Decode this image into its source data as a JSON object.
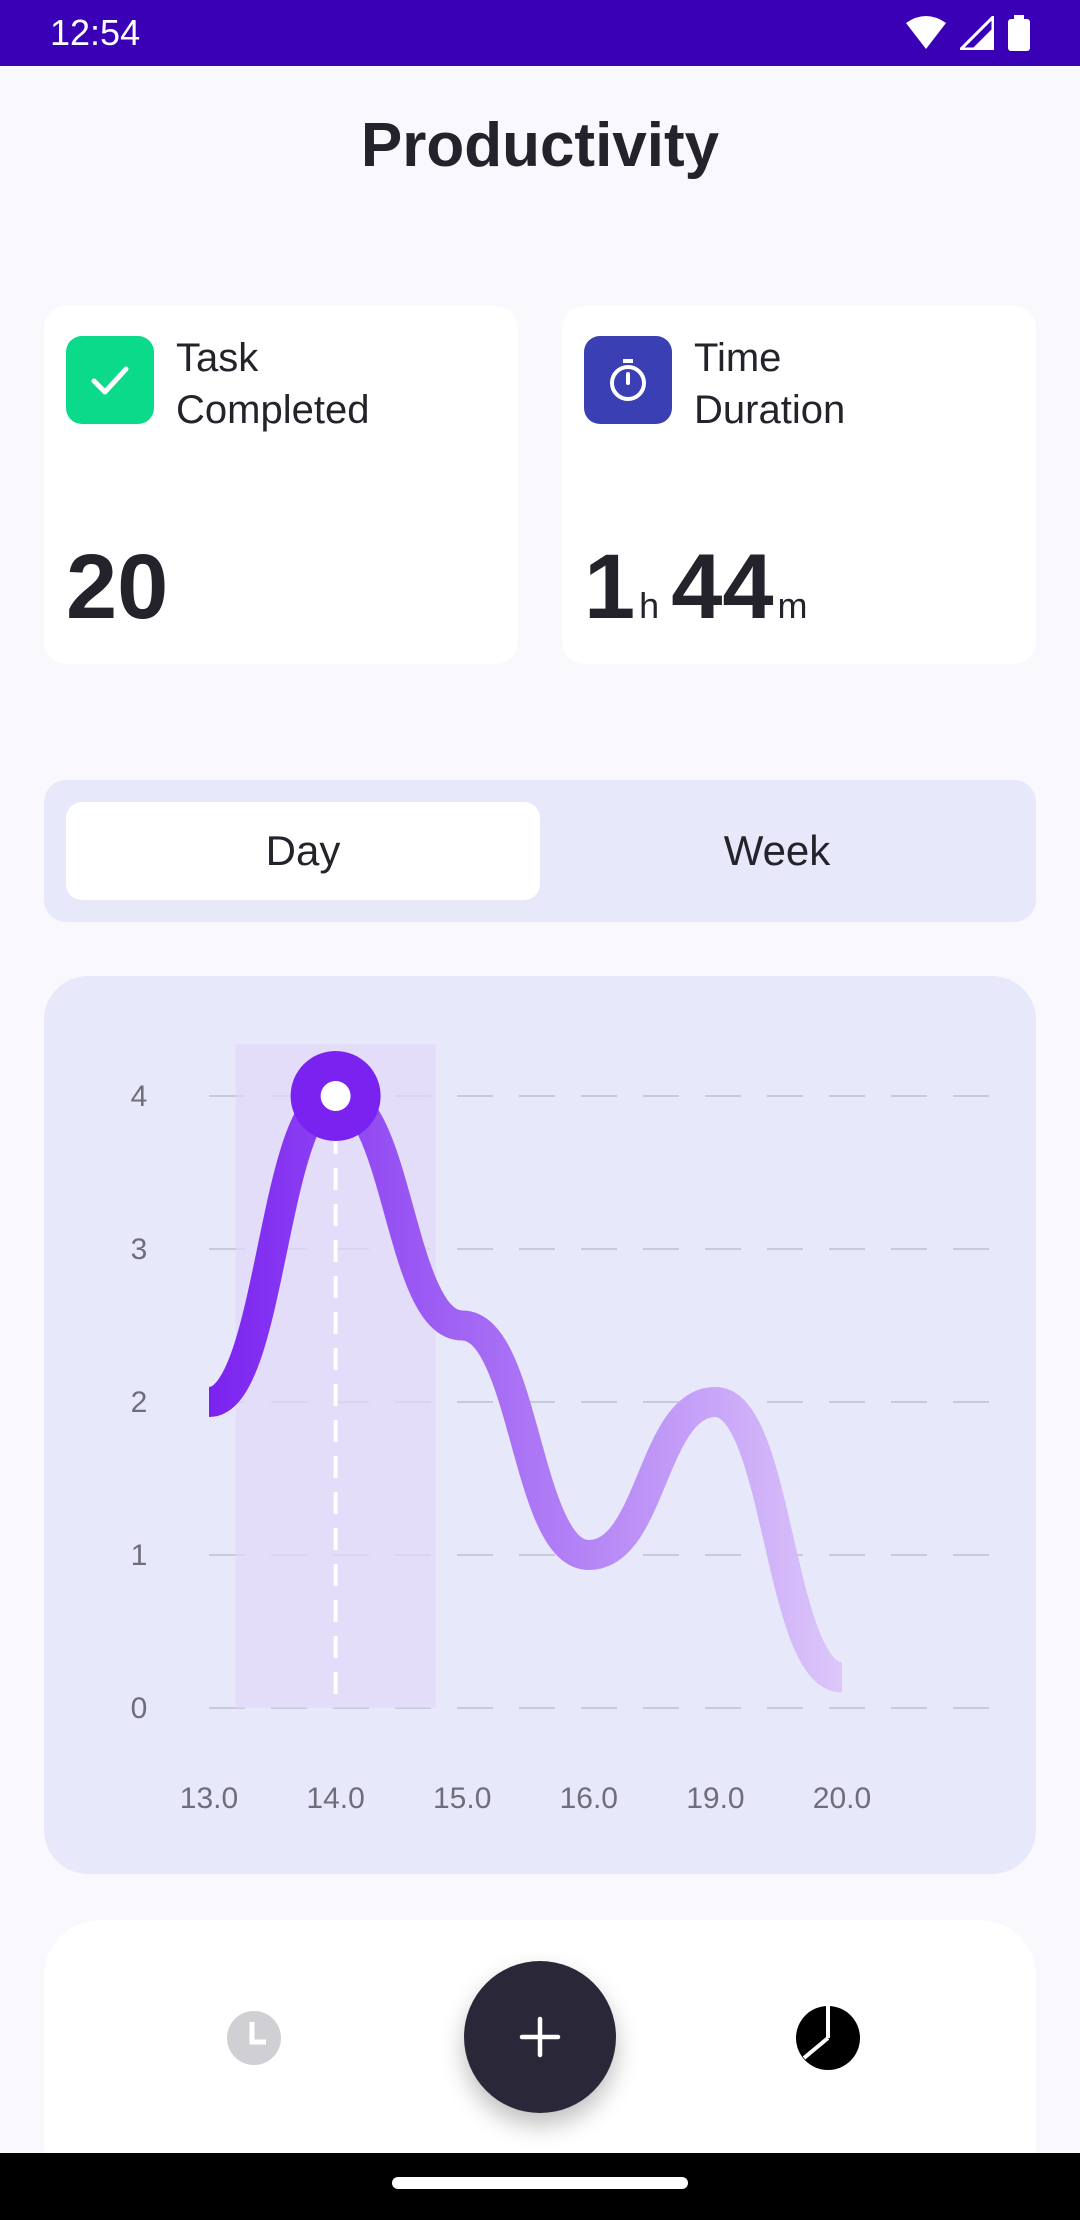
{
  "status_bar": {
    "time": "12:54",
    "icons": [
      "wifi-icon",
      "signal-icon",
      "battery-icon"
    ]
  },
  "page": {
    "title": "Productivity"
  },
  "cards": {
    "tasks": {
      "label_line1": "Task",
      "label_line2": "Completed",
      "value": "20",
      "icon": "check-icon",
      "color": "#0BDA8A"
    },
    "time": {
      "label_line1": "Time",
      "label_line2": "Duration",
      "hours": "1",
      "hours_unit": "h",
      "minutes": "44",
      "minutes_unit": "m",
      "icon": "stopwatch-icon",
      "color": "#3A3FB3"
    }
  },
  "toggle": {
    "day": "Day",
    "week": "Week",
    "selected": "Day"
  },
  "chart_data": {
    "type": "line",
    "categories": [
      "13.0",
      "14.0",
      "15.0",
      "16.0",
      "19.0",
      "20.0"
    ],
    "values": [
      2.0,
      4.0,
      2.5,
      1.0,
      2.0,
      0.2
    ],
    "yticks": [
      "0",
      "1",
      "2",
      "3",
      "4"
    ],
    "ylim": [
      0,
      4
    ],
    "highlighted_category": "14.0",
    "grid": "horizontal dashed",
    "colors": {
      "line_start": "#7A22F0",
      "line_end": "#DCC7FA",
      "highlight": "#E2D9F8"
    }
  },
  "bottom_nav": {
    "icons": [
      "clock-icon",
      "plus-icon",
      "pie-chart-icon"
    ]
  }
}
